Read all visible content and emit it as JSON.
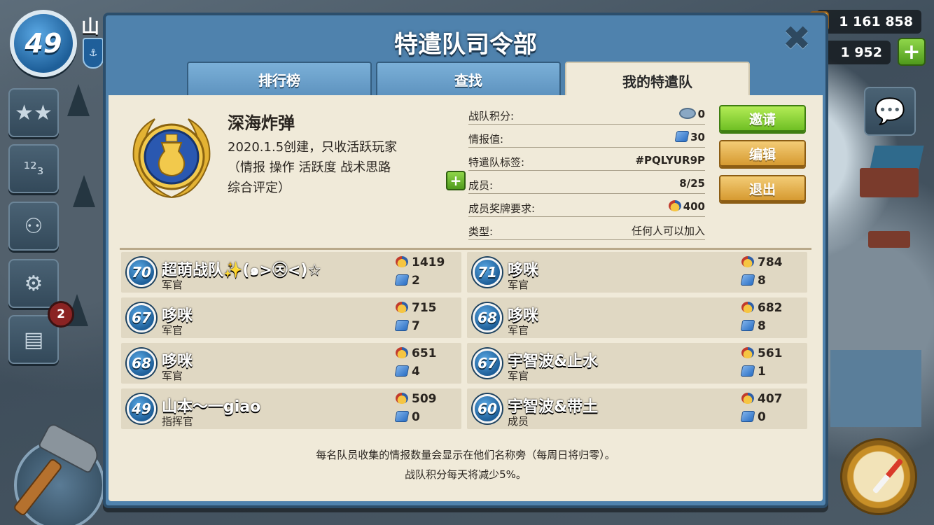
{
  "hud": {
    "player_level": "49",
    "player_name": "山",
    "resource_gold": "1 161 858",
    "resource_diamonds": "1 952",
    "notification_count": "2"
  },
  "dialog": {
    "title": "特遣队司令部",
    "close_glyph": "✖",
    "tabs": [
      {
        "label": "排行榜",
        "active": false
      },
      {
        "label": "查找",
        "active": false
      },
      {
        "label": "我的特遣队",
        "active": true
      }
    ]
  },
  "team": {
    "name": "深海炸弹",
    "description": "2020.1.5创建，只收活跃玩家\n（情报 操作 活跃度 战术思路\n综合评定）",
    "info": [
      {
        "label": "战队积分:",
        "value": "0",
        "icon": "wing-icon"
      },
      {
        "label": "情报值:",
        "value": "30",
        "icon": "intel-icon"
      },
      {
        "label": "特遣队标签:",
        "value": "#PQLYUR9P",
        "icon": ""
      },
      {
        "label": "成员:",
        "value": "8/25",
        "icon": ""
      },
      {
        "label": "成员奖牌要求:",
        "value": "400",
        "icon": "medal-icon"
      },
      {
        "label": "类型:",
        "value": "任何人可以加入",
        "icon": ""
      }
    ]
  },
  "actions": {
    "invite": "邀请",
    "edit": "编辑",
    "leave": "退出"
  },
  "members": [
    {
      "level": "70",
      "name": "超萌战队✨(๑>㉨<)☆",
      "rank": "军官",
      "medals": "1419",
      "intel": "2"
    },
    {
      "level": "71",
      "name": "哆咪",
      "rank": "军官",
      "medals": "784",
      "intel": "8"
    },
    {
      "level": "67",
      "name": "哆咪",
      "rank": "军官",
      "medals": "715",
      "intel": "7"
    },
    {
      "level": "68",
      "name": "哆咪",
      "rank": "军官",
      "medals": "682",
      "intel": "8"
    },
    {
      "level": "68",
      "name": "哆咪",
      "rank": "军官",
      "medals": "651",
      "intel": "4"
    },
    {
      "level": "67",
      "name": "宇智波&止水",
      "rank": "军官",
      "medals": "561",
      "intel": "1"
    },
    {
      "level": "49",
      "name": "山本～一giao",
      "rank": "指挥官",
      "medals": "509",
      "intel": "0"
    },
    {
      "level": "60",
      "name": "宇智波&带土",
      "rank": "成员",
      "medals": "407",
      "intel": "0"
    }
  ],
  "footer": {
    "line1": "每名队员收集的情报数量会显示在他们名称旁（每周日将归零）。",
    "line2": "战队积分每天将减少5%。"
  },
  "colors": {
    "dialog_blue": "#4f82ad",
    "panel_parchment": "#f0ead9",
    "invite_green": "#7fc82c",
    "edit_orange": "#d69a31",
    "level_blue": "#1e5f99"
  }
}
